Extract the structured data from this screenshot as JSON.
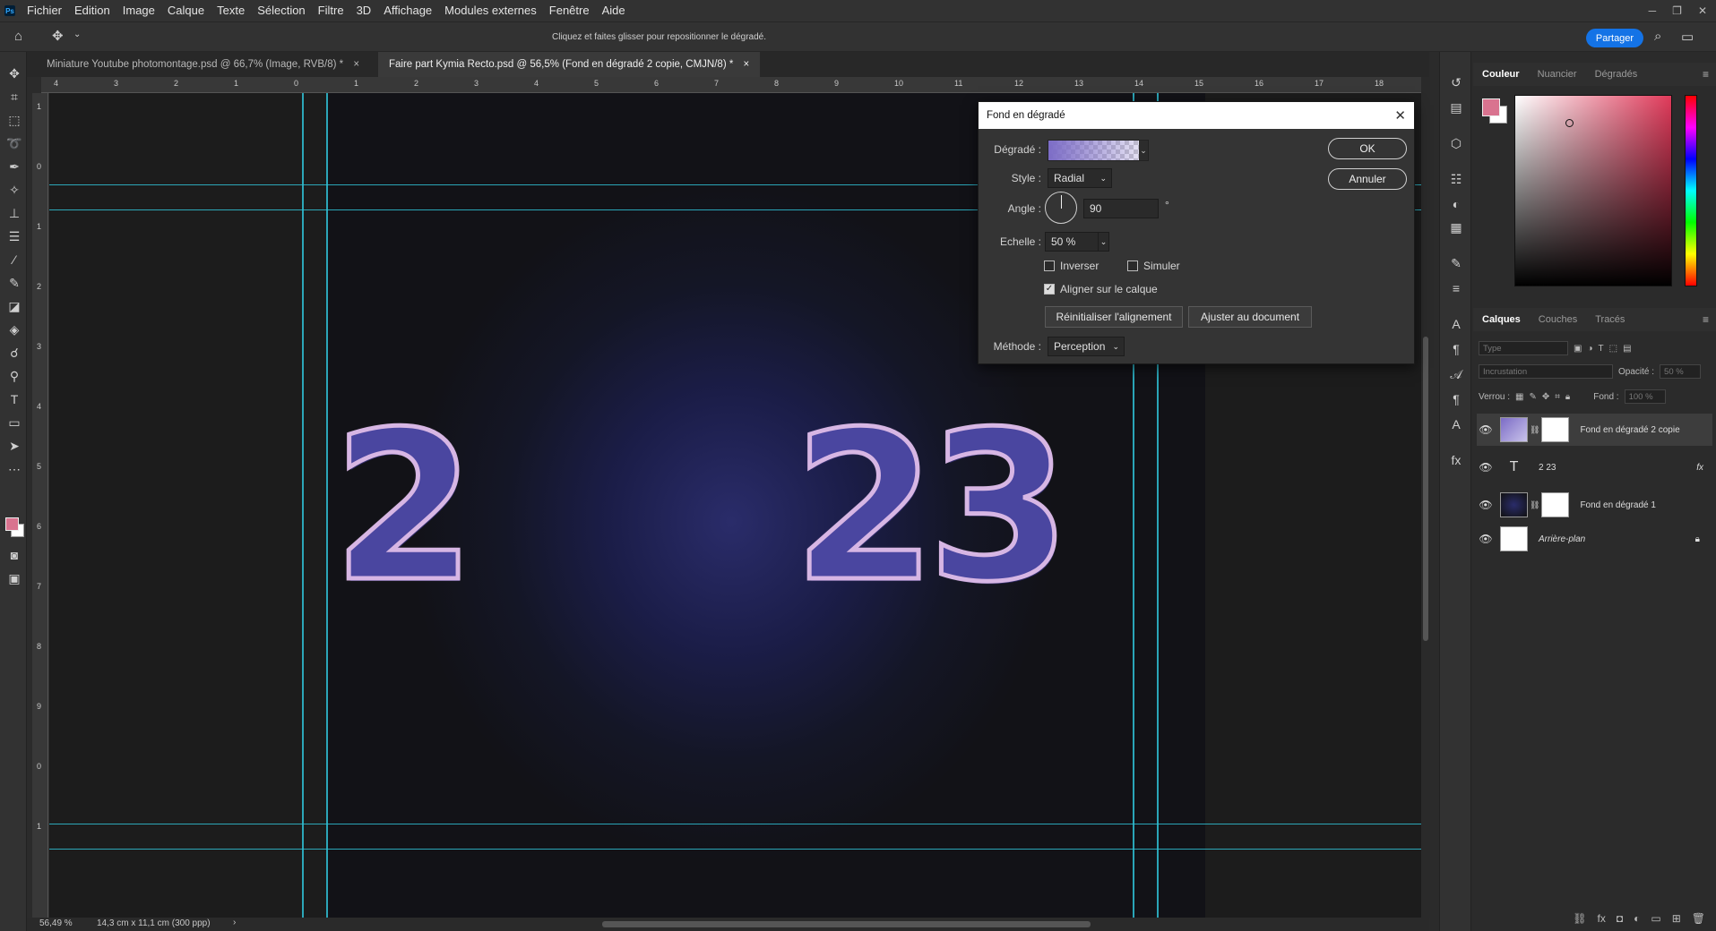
{
  "menubar": {
    "items": [
      "Fichier",
      "Edition",
      "Image",
      "Calque",
      "Texte",
      "Sélection",
      "Filtre",
      "3D",
      "Affichage",
      "Modules externes",
      "Fenêtre",
      "Aide"
    ]
  },
  "options": {
    "hint": "Cliquez et faites glisser pour repositionner le dégradé.",
    "share_label": "Partager"
  },
  "tabs": [
    {
      "label": "Miniature Youtube photomontage.psd @ 66,7% (Image, RVB/8) *"
    },
    {
      "label": "Faire part Kymia Recto.psd @ 56,5% (Fond en dégradé 2 copie, CMJN/8) *"
    }
  ],
  "ruler": {
    "h": [
      "4",
      "3",
      "2",
      "1",
      "0",
      "1",
      "2",
      "3",
      "4",
      "5",
      "6",
      "7",
      "8",
      "9",
      "10",
      "11",
      "12",
      "13",
      "14",
      "15",
      "16",
      "17",
      "18"
    ],
    "v": [
      "1",
      "0",
      "1",
      "2",
      "3",
      "4",
      "5",
      "6",
      "7",
      "8",
      "9",
      "0",
      "1"
    ]
  },
  "canvas": {
    "left_digits": "2",
    "right_digits": "23"
  },
  "status": {
    "zoom": "56,49 %",
    "doc_info": "14,3 cm x 11,1 cm (300 ppp)"
  },
  "color_panel": {
    "tabs": [
      "Couleur",
      "Nuancier",
      "Dégradés"
    ],
    "fg_color": "#d9738f",
    "bg_color": "#ffffff"
  },
  "layers_panel": {
    "tabs": [
      "Calques",
      "Couches",
      "Tracés"
    ],
    "search_placeholder": "Type",
    "blend_mode": "Incrustation",
    "opacity_label": "Opacité :",
    "opacity_value": "50 %",
    "lock_label": "Verrou :",
    "fill_label": "Fond :",
    "fill_value": "100 %",
    "layers": [
      {
        "name": "Fond en dégradé 2 copie",
        "kind": "gradient",
        "selected": true
      },
      {
        "name": "2      23",
        "kind": "text",
        "selected": false
      },
      {
        "name": "Fond en dégradé 1",
        "kind": "gradient-dark",
        "selected": false
      },
      {
        "name": "Arrière-plan",
        "kind": "background",
        "selected": false
      }
    ]
  },
  "dialog": {
    "title": "Fond en dégradé",
    "gradient_label": "Dégradé :",
    "style_label": "Style :",
    "style_value": "Radial",
    "angle_label": "Angle :",
    "angle_value": "90",
    "angle_unit": "°",
    "scale_label": "Echelle :",
    "scale_value": "50 %",
    "invert_label": "Inverser",
    "invert_checked": false,
    "dither_label": "Simuler",
    "dither_checked": false,
    "align_label": "Aligner sur le calque",
    "align_checked": true,
    "reset_align_label": "Réinitialiser l'alignement",
    "fit_doc_label": "Ajuster au document",
    "method_label": "Méthode :",
    "method_value": "Perception",
    "ok_label": "OK",
    "cancel_label": "Annuler"
  }
}
